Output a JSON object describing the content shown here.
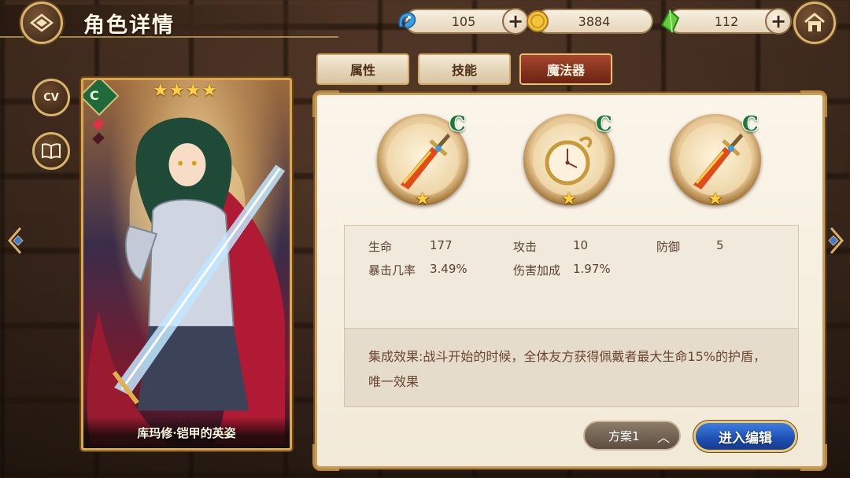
{
  "header": {
    "title": "角色详情",
    "back_icon": "diamond-back-icon",
    "home_icon": "home-icon"
  },
  "resources": [
    {
      "name": "blue-spirit",
      "icon": "blue-spirit-icon",
      "value": "105"
    },
    {
      "name": "gold-coin",
      "icon": "gold-coin-icon",
      "value": "3884"
    },
    {
      "name": "green-gem",
      "icon": "green-gem-icon",
      "value": "112"
    }
  ],
  "side_buttons": {
    "cv_label": "CV",
    "book_icon": "book-icon"
  },
  "character": {
    "name": "库玛修·铠甲的英姿",
    "stars": 4,
    "class_icon": "green-class-icon"
  },
  "tabs": [
    {
      "label": "属性",
      "active": false
    },
    {
      "label": "技能",
      "active": false
    },
    {
      "label": "魔法器",
      "active": true
    }
  ],
  "magic_items": [
    {
      "icon": "fire-sword-icon",
      "grade": "C",
      "stars": 1
    },
    {
      "icon": "pocket-watch-icon",
      "grade": "C",
      "stars": 1
    },
    {
      "icon": "fire-sword-icon",
      "grade": "C",
      "stars": 1
    }
  ],
  "stats": {
    "row1": [
      {
        "name": "生命",
        "value": "177"
      },
      {
        "name": "攻击",
        "value": "10"
      },
      {
        "name": "防御",
        "value": "5"
      }
    ],
    "row2": [
      {
        "name": "暴击几率",
        "value": "3.49%"
      },
      {
        "name": "伤害加成",
        "value": "1.97%"
      }
    ]
  },
  "set_bonus": "集成效果:战斗开始的时候，全体友方获得佩戴者最大生命15%的护盾，唯一效果",
  "footer": {
    "scheme_label": "方案1",
    "enter_label": "进入编辑"
  },
  "colors": {
    "active_tab": "#a6452c",
    "enter_button": "#2a62c8",
    "grade_green": "#1f7a3a",
    "star_gold": "#ffcf3c"
  }
}
